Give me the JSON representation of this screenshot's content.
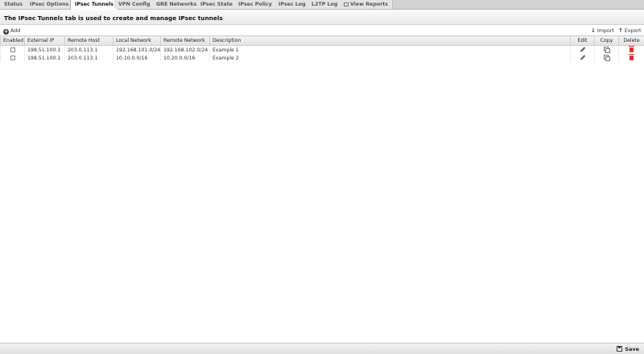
{
  "tabs": [
    {
      "label": "Status",
      "active": false
    },
    {
      "label": "IPsec Options",
      "active": false
    },
    {
      "label": "IPsec Tunnels",
      "active": true
    },
    {
      "label": "VPN Config",
      "active": false
    },
    {
      "label": "GRE Networks",
      "active": false
    },
    {
      "label": "IPsec State",
      "active": false
    },
    {
      "label": "IPsec Policy",
      "active": false
    },
    {
      "label": "IPsec Log",
      "active": false
    },
    {
      "label": "L2TP Log",
      "active": false
    },
    {
      "label": "View Reports",
      "active": false
    }
  ],
  "heading": "The IPsec Tunnels tab is used to create and manage IPsec tunnels",
  "toolbar": {
    "add_label": "Add",
    "import_label": "Import",
    "export_label": "Export"
  },
  "table": {
    "headers": {
      "enabled": "Enabled",
      "external_ip": "External IP",
      "remote_host": "Remote Host",
      "local_network": "Local Network",
      "remote_network": "Remote Network",
      "description": "Description",
      "edit": "Edit",
      "copy": "Copy",
      "delete": "Delete"
    },
    "rows": [
      {
        "external_ip": "198.51.100.1",
        "remote_host": "203.0.113.1",
        "local_network": "192.168.101.0/24",
        "remote_network": "192.168.102.0/24",
        "description": "Example 1"
      },
      {
        "external_ip": "198.51.100.1",
        "remote_host": "203.0.113.1",
        "local_network": "10.10.0.0/16",
        "remote_network": "10.20.0.0/16",
        "description": "Example 2"
      }
    ]
  },
  "footer": {
    "save_label": "Save"
  }
}
